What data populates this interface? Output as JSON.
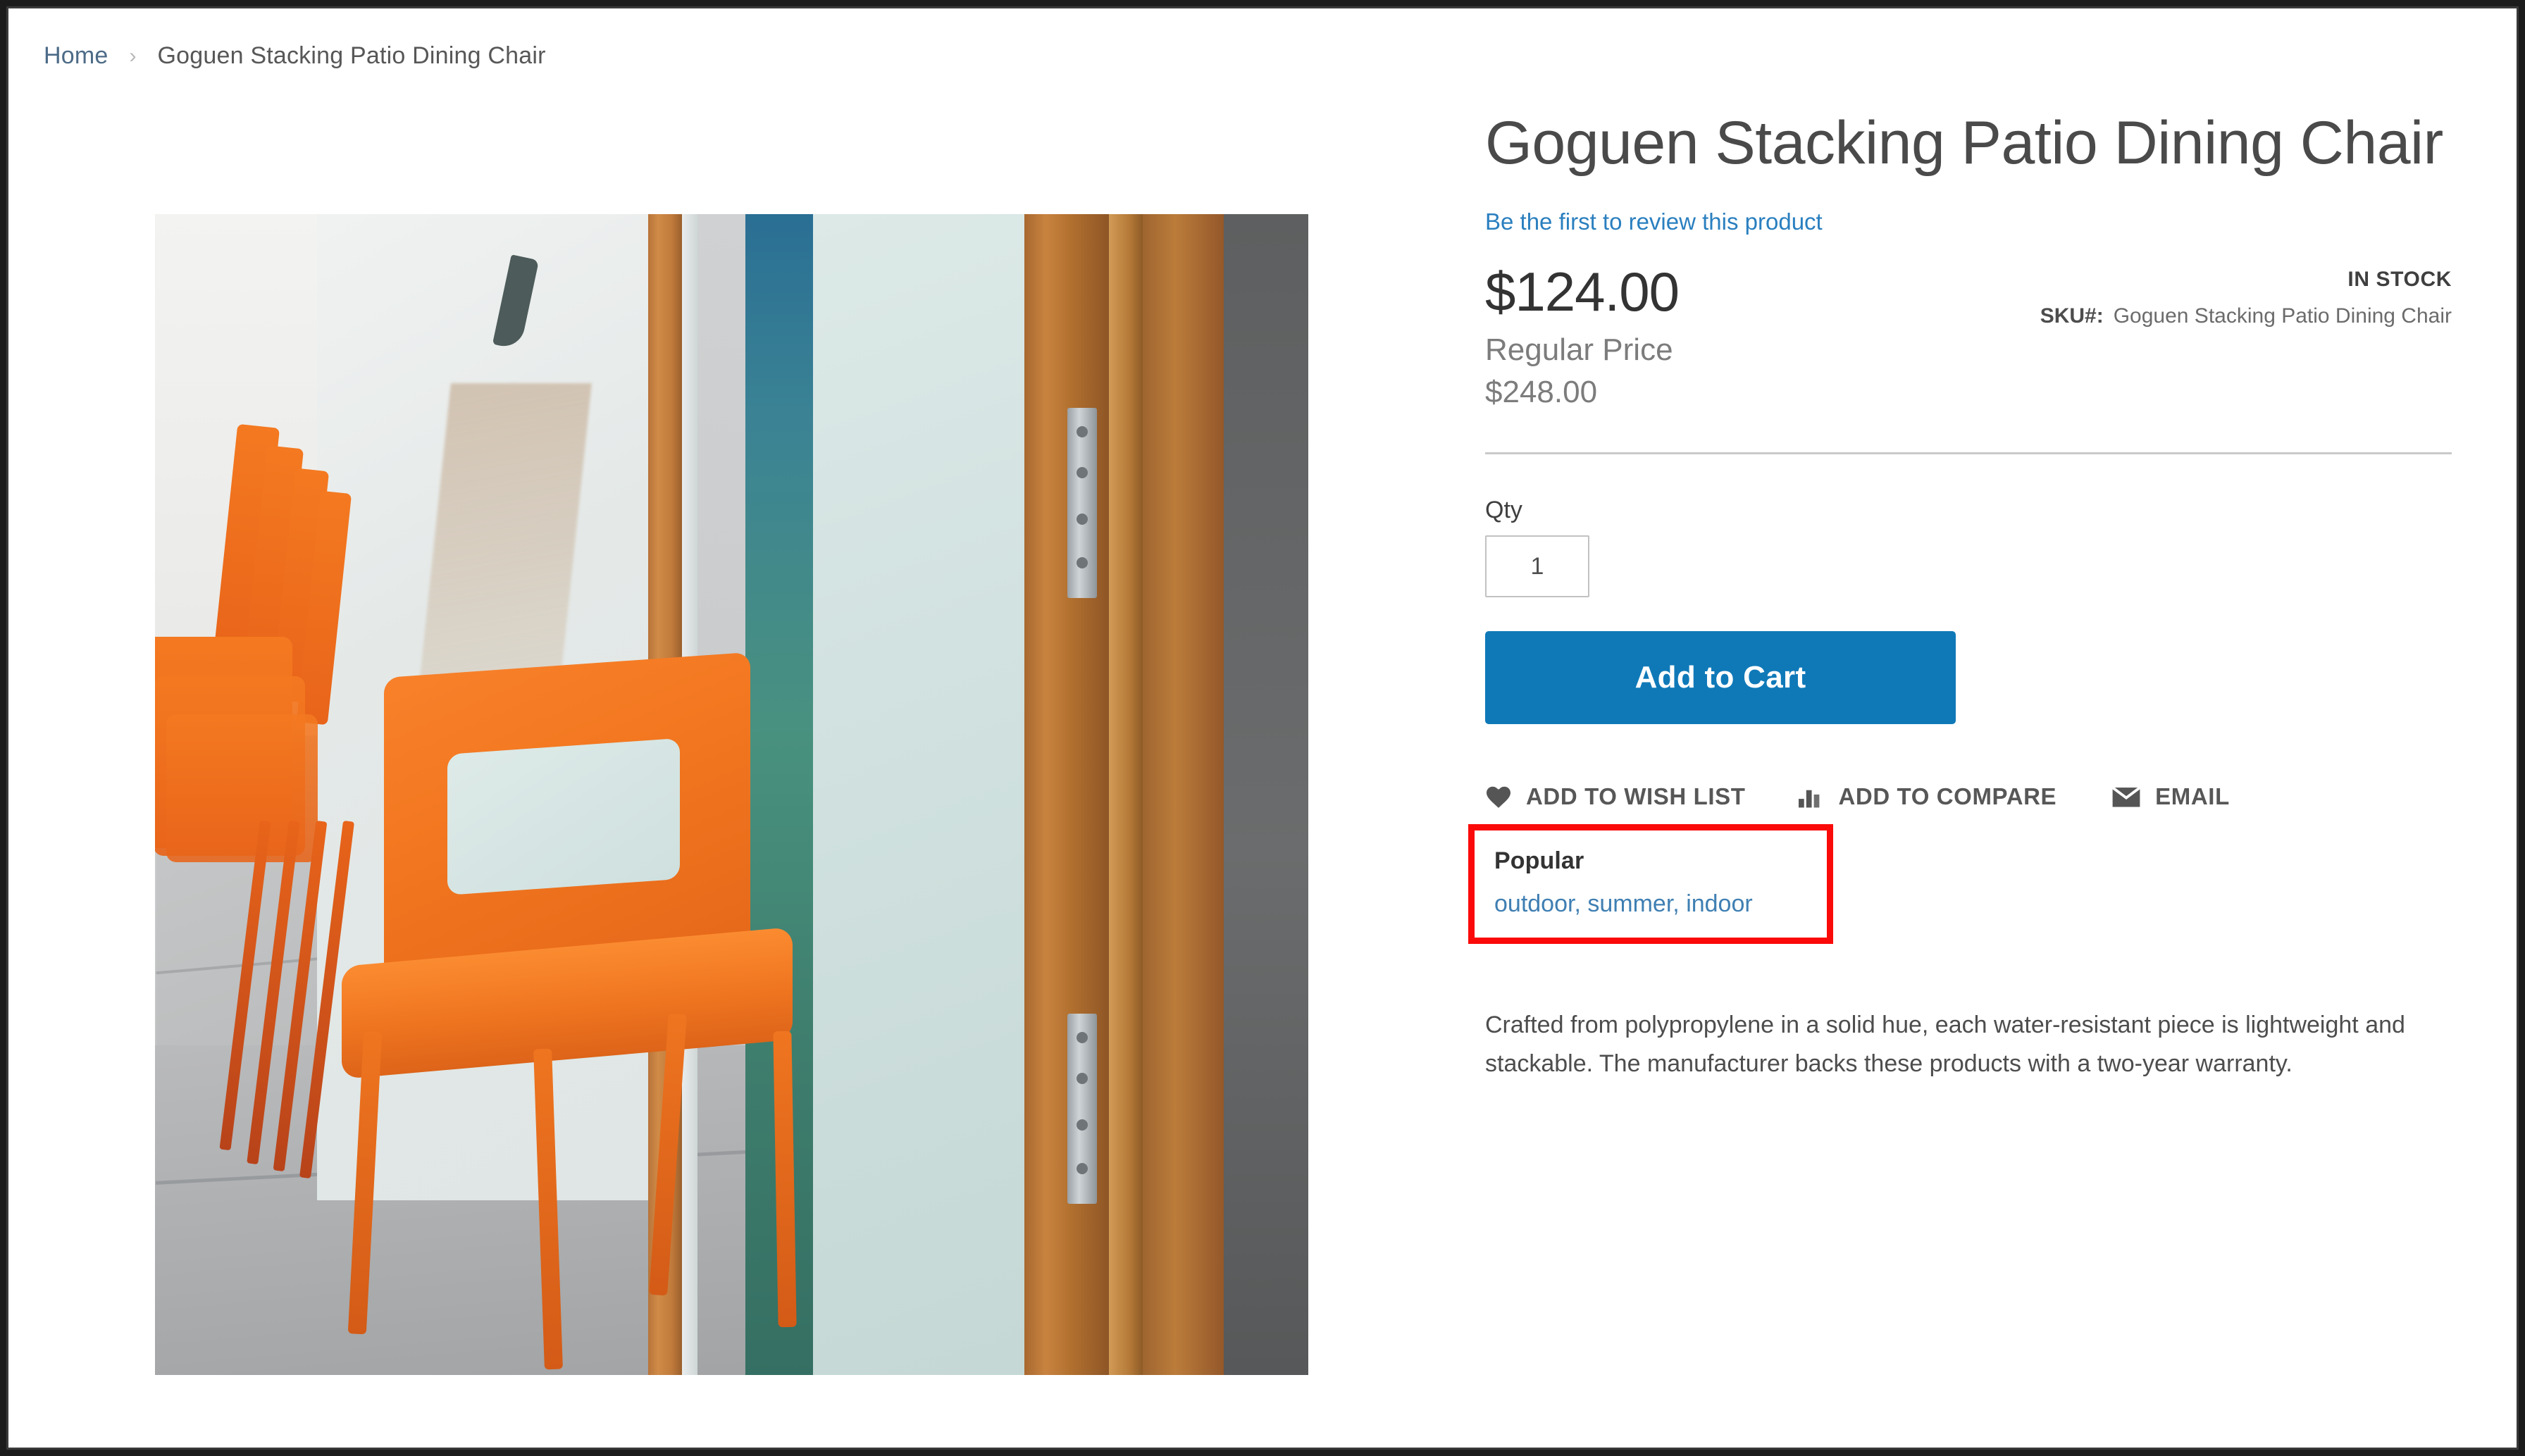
{
  "breadcrumb": {
    "home_label": "Home",
    "separator": "›",
    "current_label": "Goguen Stacking Patio Dining Chair"
  },
  "product": {
    "title": "Goguen Stacking Patio Dining Chair",
    "review_link_label": "Be the first to review this product",
    "final_price": "$124.00",
    "regular_price_label": "Regular Price",
    "old_price": "$248.00",
    "stock_status": "IN STOCK",
    "sku_label": "SKU#:",
    "sku_value": "Goguen Stacking Patio Dining Chair",
    "description": "Crafted from polypropylene in a solid hue, each water-resistant piece is lightweight and stackable. The manufacturer backs these products with a two-year warranty.",
    "image_alt": "Goguen Stacking Patio Dining Chair"
  },
  "purchase": {
    "qty_label": "Qty",
    "qty_value": "1",
    "qty_placeholder": "1",
    "add_to_cart_label": "Add to Cart"
  },
  "social": {
    "wishlist_label": "ADD TO WISH LIST",
    "wishlist_icon": "heart-icon",
    "compare_label": "ADD TO COMPARE",
    "compare_icon": "bar-chart-icon",
    "email_label": "EMAIL",
    "email_icon": "envelope-icon"
  },
  "tags": {
    "heading": "Popular",
    "items": [
      "outdoor",
      "summer",
      "indoor"
    ],
    "joined": "outdoor, summer, indoor",
    "highlight_color": "#fb0a0a"
  },
  "colors": {
    "accent_button": "#0f79b8",
    "link": "#2a7fbf",
    "tag_link": "#3f7fb3",
    "text": "#4a4a4a",
    "muted_text": "#7c7c7c",
    "divider": "#c9c9c9",
    "highlight_border": "#fb0a0a"
  }
}
